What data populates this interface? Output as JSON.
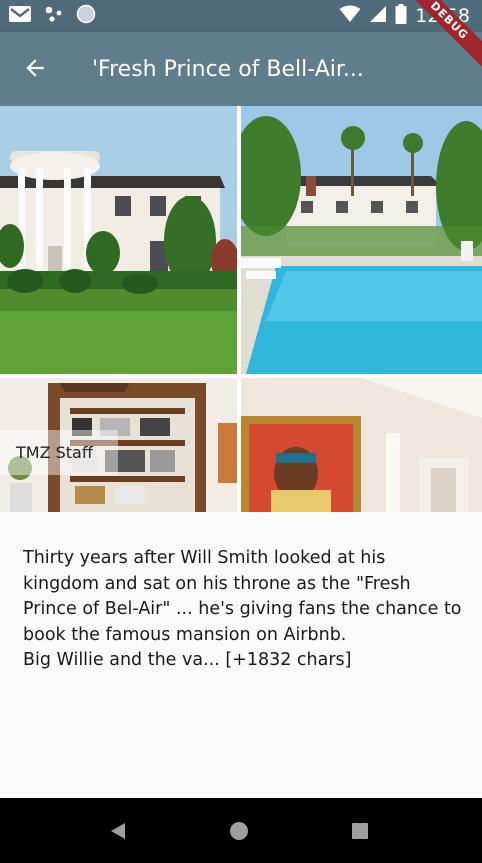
{
  "status_bar": {
    "time": "12:58",
    "icons": [
      "gmail-icon",
      "notification-dots-icon",
      "sync-circle-icon",
      "wifi-icon",
      "signal-icon",
      "battery-icon"
    ]
  },
  "debug_banner": "DEBUG",
  "app_bar": {
    "back_icon": "arrow-back-icon",
    "title": "'Fresh Prince of Bell-Air..."
  },
  "gallery": {
    "author_overlay": "TMZ Staff",
    "images": [
      "mansion-exterior",
      "pool-and-palms",
      "living-room-shelves",
      "portrait-painting"
    ]
  },
  "article": {
    "paragraph_1": "Thirty years after Will Smith looked at his kingdom and sat on his throne as the \"Fresh Prince of Bel-Air\" ... he's giving fans the chance to book the famous mansion on Airbnb.",
    "paragraph_2": "Big Willie and the va... [+1832 chars]"
  },
  "nav_bar": {
    "buttons": [
      "back-triangle-icon",
      "home-circle-icon",
      "recents-square-icon"
    ]
  },
  "colors": {
    "status_bar": "#4f6a78",
    "app_bar": "#607d8b",
    "debug_ribbon": "#a0262c",
    "nav_bar": "#000000"
  }
}
